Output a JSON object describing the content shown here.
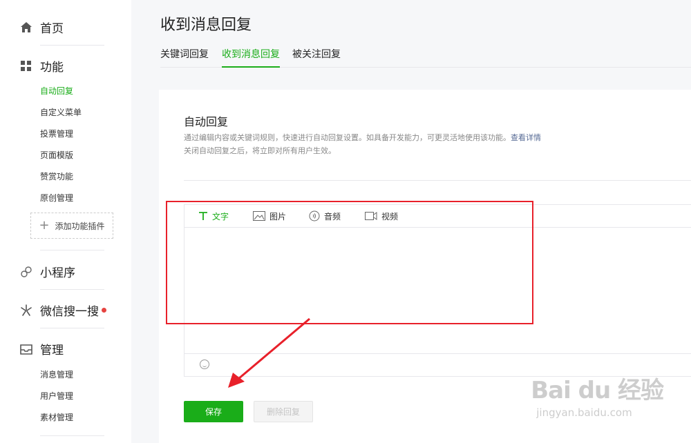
{
  "sidebar": {
    "home": "首页",
    "functions": {
      "label": "功能",
      "items": [
        "自动回复",
        "自定义菜单",
        "投票管理",
        "页面模版",
        "赞赏功能",
        "原创管理"
      ],
      "add_plugin": "添加功能插件"
    },
    "miniprogram": "小程序",
    "wechat_search": "微信搜一搜",
    "manage": {
      "label": "管理",
      "items": [
        "消息管理",
        "用户管理",
        "素材管理"
      ]
    }
  },
  "header": {
    "title": "收到消息回复",
    "tabs": [
      "关键词回复",
      "收到消息回复",
      "被关注回复"
    ],
    "active_tab": "收到消息回复"
  },
  "main": {
    "section_title": "自动回复",
    "desc_line1": "通过编辑内容或关键词规则，快速进行自动回复设置。如具备开发能力，可更灵活地使用该功能。",
    "desc_link": "查看详情",
    "desc_line2": "关闭自动回复之后，将立即对所有用户生效。",
    "editor_tabs": [
      "文字",
      "图片",
      "音频",
      "视频"
    ],
    "save_label": "保存",
    "delete_label": "删除回复"
  },
  "colors": {
    "accent": "#1aad19",
    "annotation": "#e8202a",
    "link": "#576b95"
  },
  "watermark": {
    "logo": "Bai du 经验",
    "url": "jingyan.baidu.com"
  }
}
